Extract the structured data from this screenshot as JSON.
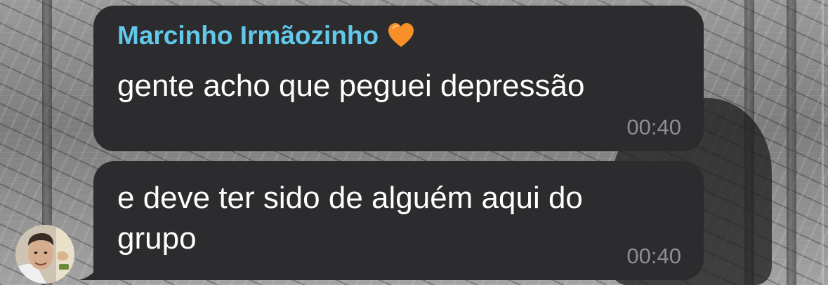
{
  "background": {
    "style": "manga-gray"
  },
  "messages": [
    {
      "sender": "Marcinho Irmãozinho",
      "sender_emoji_icon": "orange-heart-icon",
      "text": "gente acho que peguei depressão",
      "time": "00:40"
    },
    {
      "text": "e deve ter sido de alguém aqui do grupo",
      "time": "00:40"
    }
  ],
  "colors": {
    "bubble": "#2c2c2e",
    "sender_name": "#62c8e8",
    "timestamp": "#8e8e93",
    "heart": "#f7902b"
  }
}
